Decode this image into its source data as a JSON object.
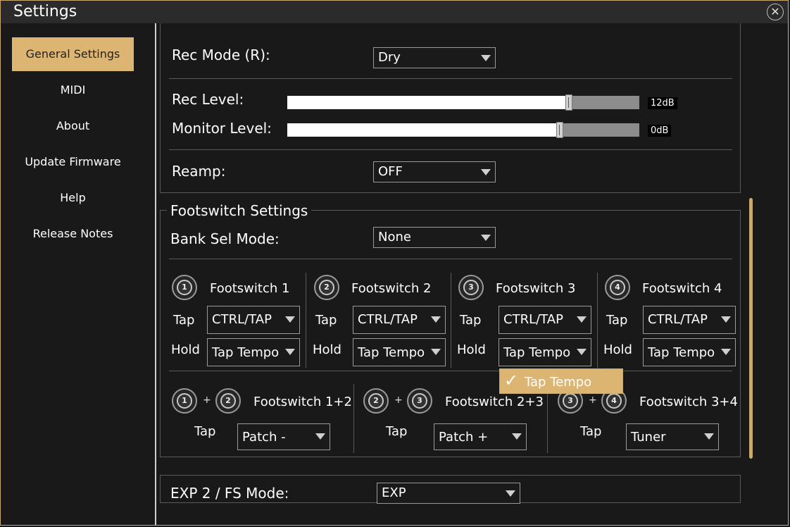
{
  "window": {
    "title": "Settings",
    "close_icon": "close-icon"
  },
  "sidebar": {
    "items": [
      {
        "label": "General Settings",
        "active": true
      },
      {
        "label": "MIDI"
      },
      {
        "label": "About"
      },
      {
        "label": "Update Firmware"
      },
      {
        "label": "Help"
      },
      {
        "label": "Release Notes"
      }
    ]
  },
  "recording": {
    "rec_mode_label": "Rec Mode (R):",
    "rec_mode_value": "Dry",
    "rec_level_label": "Rec Level:",
    "rec_level_value": "12dB",
    "rec_level_fraction": 0.8,
    "monitor_level_label": "Monitor Level:",
    "monitor_level_value": "0dB",
    "monitor_level_fraction": 0.773,
    "reamp_label": "Reamp:",
    "reamp_value": "OFF"
  },
  "footswitch": {
    "title": "Footswitch Settings",
    "bank_sel_label": "Bank Sel Mode:",
    "bank_sel_value": "None",
    "tap_label": "Tap",
    "hold_label": "Hold",
    "switches": [
      {
        "name": "Footswitch 1",
        "num": "1",
        "tap": "CTRL/TAP",
        "hold": "Tap Tempo"
      },
      {
        "name": "Footswitch 2",
        "num": "2",
        "tap": "CTRL/TAP",
        "hold": "Tap Tempo"
      },
      {
        "name": "Footswitch 3",
        "num": "3",
        "tap": "CTRL/TAP",
        "hold": "Tap Tempo"
      },
      {
        "name": "Footswitch 4",
        "num": "4",
        "tap": "CTRL/TAP",
        "hold": "Tap Tempo"
      }
    ],
    "plus": "+",
    "combos": [
      {
        "name": "Footswitch 1+2",
        "a": "1",
        "b": "2",
        "tap": "Patch -"
      },
      {
        "name": "Footswitch 2+3",
        "a": "2",
        "b": "3",
        "tap": "Patch +"
      },
      {
        "name": "Footswitch 3+4",
        "a": "3",
        "b": "4",
        "tap": "Tuner"
      }
    ]
  },
  "dropdown_open": {
    "check": "✓",
    "option": "Tap Tempo"
  },
  "exp": {
    "label": "EXP 2 / FS Mode:",
    "value": "EXP"
  },
  "colors": {
    "accent": "#ddb572",
    "background": "#191919",
    "border": "#c9ab72"
  }
}
